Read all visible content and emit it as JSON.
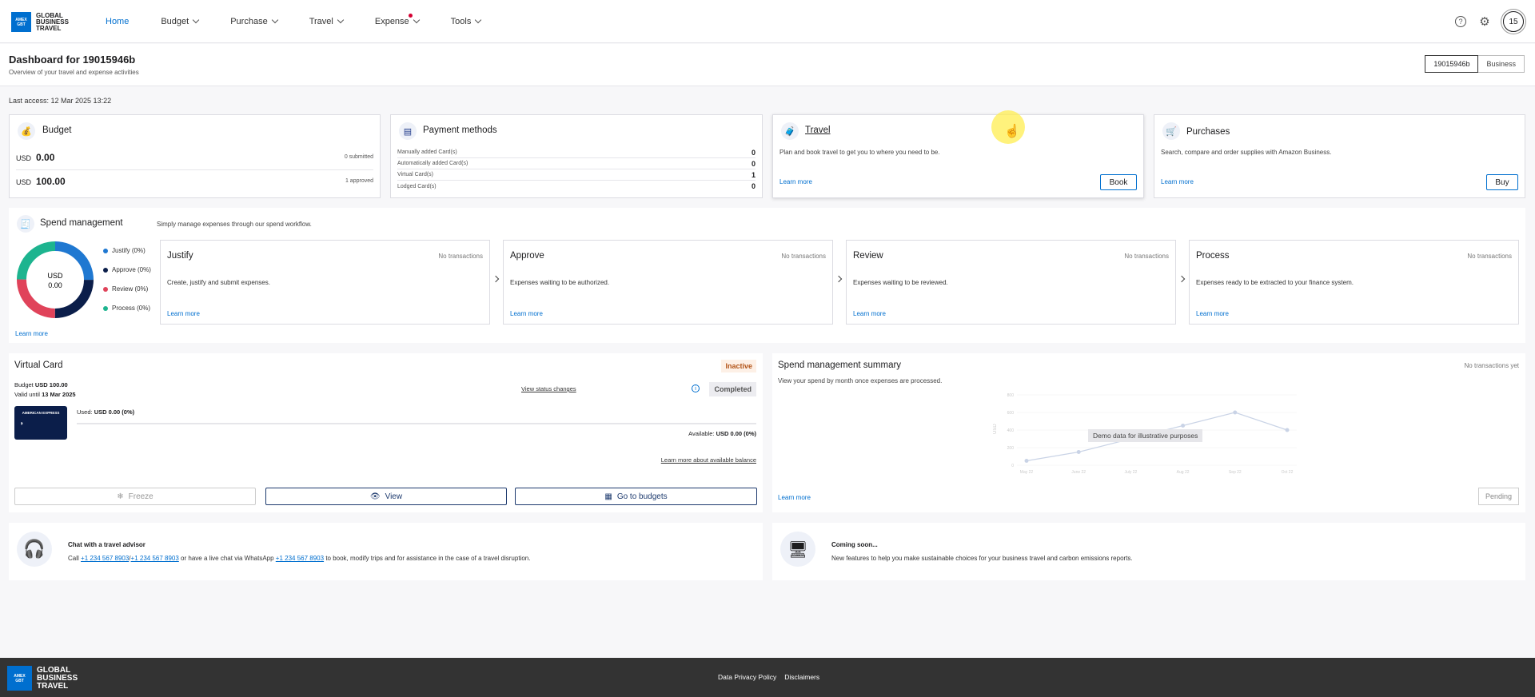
{
  "brand": {
    "logo_text_line1": "GLOBAL",
    "logo_text_line2": "BUSINESS",
    "logo_text_line3": "TRAVEL",
    "badge": "AMERICAN EXPRESS"
  },
  "nav": {
    "items": [
      {
        "label": "Home",
        "active": true
      },
      {
        "label": "Budget"
      },
      {
        "label": "Purchase"
      },
      {
        "label": "Travel"
      },
      {
        "label": "Expense",
        "notification": true
      },
      {
        "label": "Tools"
      }
    ],
    "avatar": "15",
    "help_icon": "?",
    "settings_icon": "⚙"
  },
  "header": {
    "title": "Dashboard for 19015946b",
    "subtitle": "Overview of your travel and expense activities",
    "account_toggle": [
      "19015946b",
      "Business"
    ]
  },
  "last_access": "Last access: 12 Mar 2025 13:22",
  "budget": {
    "title": "Budget",
    "rows": [
      {
        "currency": "USD",
        "amount": "0.00",
        "status": "0 submitted"
      },
      {
        "currency": "USD",
        "amount": "100.00",
        "status": "1 approved"
      }
    ]
  },
  "payment_methods": {
    "title": "Payment methods",
    "rows": [
      {
        "label": "Manually added Card(s)",
        "count": "0"
      },
      {
        "label": "Automatically added Card(s)",
        "count": "0"
      },
      {
        "label": "Virtual Card(s)",
        "count": "1"
      },
      {
        "label": "Lodged Card(s)",
        "count": "0"
      }
    ]
  },
  "travel": {
    "title": "Travel",
    "desc": "Plan and book travel to get you to where you need to be.",
    "link": "Learn more",
    "button": "Book"
  },
  "purchases": {
    "title": "Purchases",
    "desc": "Search, compare and order supplies with Amazon Business.",
    "link": "Learn more",
    "button": "Buy"
  },
  "spend": {
    "title": "Spend management",
    "subtitle": "Simply manage expenses through our spend workflow.",
    "donut_currency": "USD",
    "donut_amount": "0.00",
    "legend": [
      {
        "label": "Justify (0%)",
        "color": "#1f78d1"
      },
      {
        "label": "Approve (0%)",
        "color": "#0b1e4a"
      },
      {
        "label": "Review (0%)",
        "color": "#e0435a"
      },
      {
        "label": "Process (0%)",
        "color": "#1db48f"
      }
    ],
    "link": "Learn more",
    "steps": [
      {
        "title": "Justify",
        "status": "No transactions",
        "desc": "Create, justify and submit expenses.",
        "link": "Learn more"
      },
      {
        "title": "Approve",
        "status": "No transactions",
        "desc": "Expenses waiting to be authorized.",
        "link": "Learn more"
      },
      {
        "title": "Review",
        "status": "No transactions",
        "desc": "Expenses waiting to be reviewed.",
        "link": "Learn more"
      },
      {
        "title": "Process",
        "status": "No transactions",
        "desc": "Expenses ready to be extracted to your finance system.",
        "link": "Learn more"
      }
    ]
  },
  "virtual_card": {
    "title": "Virtual Card",
    "status": "Inactive",
    "budget_label": "Budget",
    "budget_value": "USD 100.00",
    "valid_label": "Valid until",
    "valid_value": "13 Mar 2025",
    "view_status": "View status changes",
    "completed": "Completed",
    "used_label": "Used:",
    "used_value": "USD 0.00 (0%)",
    "available_label": "Available:",
    "available_value": "USD 0.00 (0%)",
    "learn_balance": "Learn more about available balance",
    "buttons": {
      "freeze": "Freeze",
      "view": "View",
      "budgets": "Go to budgets"
    },
    "card_brand": "AMERICAN EXPRESS"
  },
  "summary": {
    "title": "Spend management summary",
    "subtitle": "View your spend by month once expenses are processed.",
    "no_tx": "No transactions yet",
    "demo_label": "Demo data for illustrative purposes",
    "link": "Learn more",
    "pending": "Pending"
  },
  "chart_data": {
    "type": "line",
    "x": [
      "May 22",
      "June 22",
      "July 22",
      "Aug 22",
      "Sep 22",
      "Oct 22"
    ],
    "values": [
      50,
      150,
      300,
      450,
      600,
      400
    ],
    "ylabel": "USD",
    "yticks": [
      "0",
      "200",
      "400",
      "600",
      "800"
    ],
    "ylim": [
      0,
      800
    ],
    "grid": true
  },
  "advisor": {
    "title": "Chat with a travel advisor",
    "text_1": "Call",
    "phone_1": "+1 234 567 8903",
    "sep": "/",
    "phone_2": "+1 234 567 8903",
    "text_2": "or have a live chat via WhatsApp",
    "phone_3": "+1 234 567 8903",
    "text_3": "to book, modify trips and for assistance in the case of a travel disruption."
  },
  "coming_soon": {
    "title": "Coming soon...",
    "desc": "New features to help you make sustainable choices for your business travel and carbon emissions reports."
  },
  "footer": {
    "links": [
      "Data Privacy Policy",
      "Disclaimers"
    ]
  }
}
